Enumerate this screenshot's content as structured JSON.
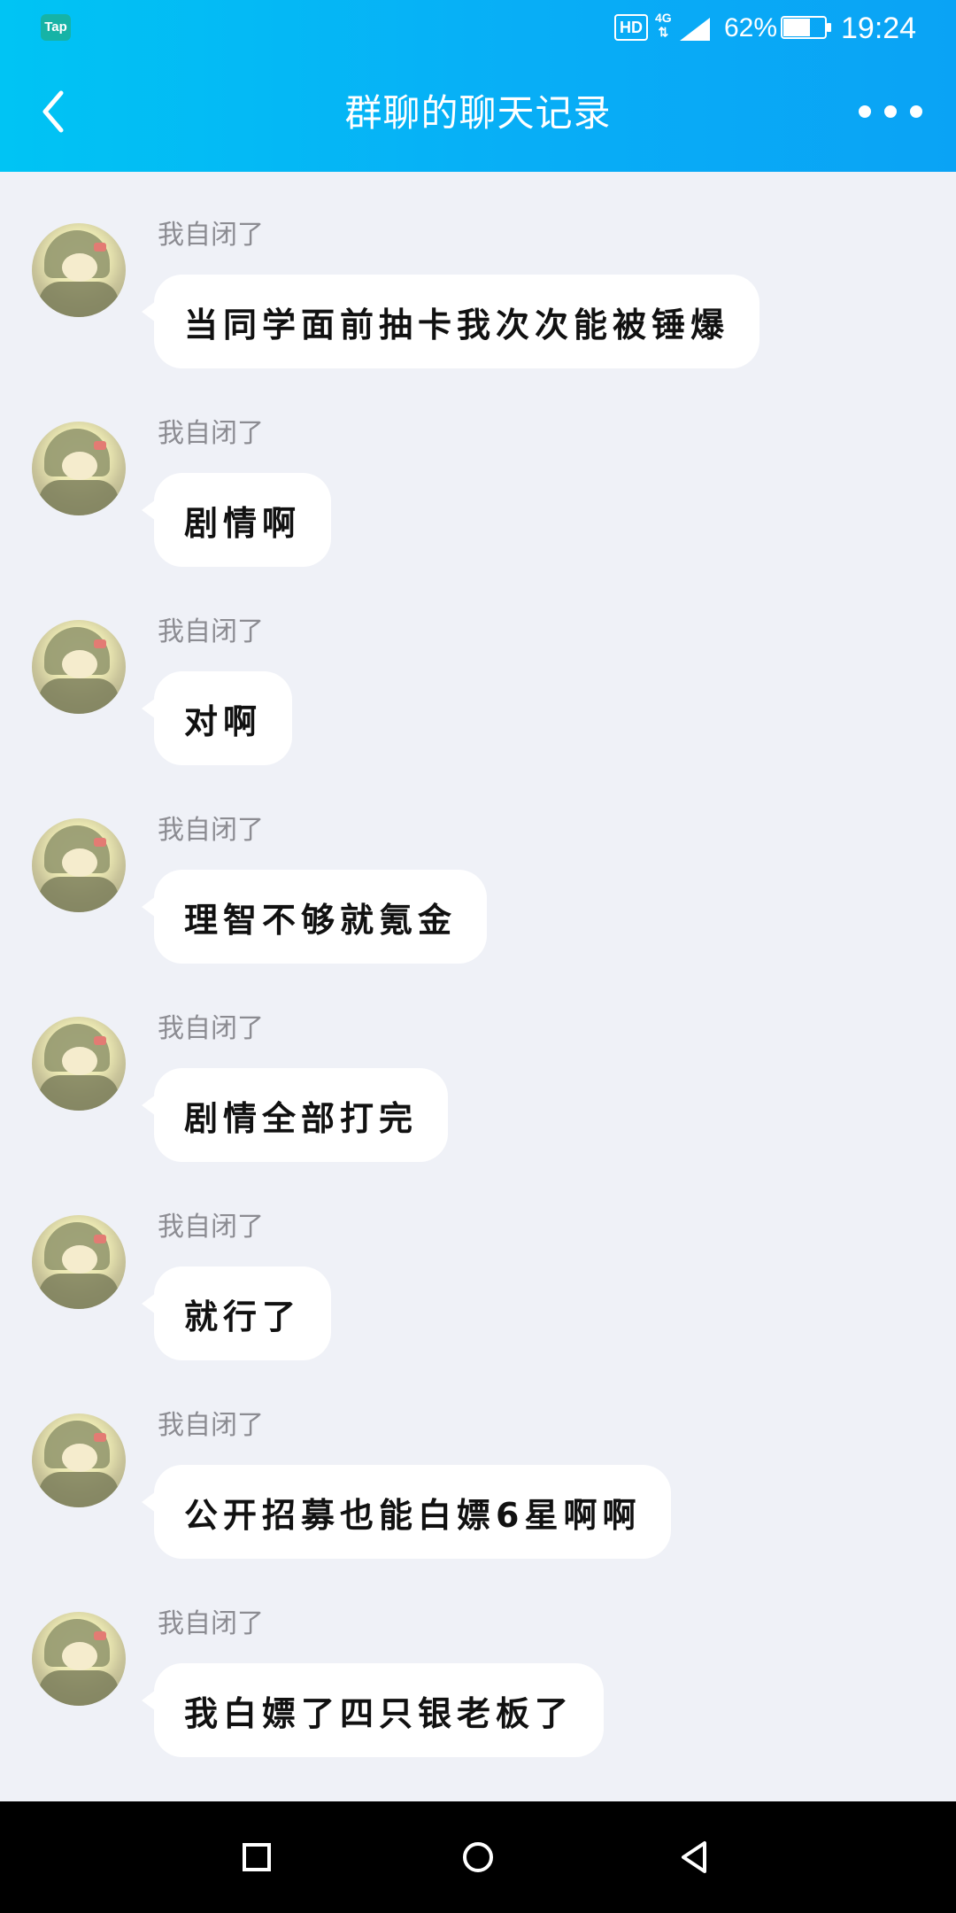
{
  "status_bar": {
    "app_badge": "Tap",
    "hd_badge": "HD",
    "network": "4G",
    "battery": "62%",
    "time": "19:24",
    "icons": [
      "tap-app-icon",
      "hd-icon",
      "4g-icon",
      "signal-icon",
      "battery-icon"
    ]
  },
  "header": {
    "title": "群聊的聊天记录",
    "back_icon": "chevron-left-icon",
    "more_icon": "more-horizontal-icon"
  },
  "messages": [
    {
      "sender": "我自闭了",
      "text": "当同学面前抽卡我次次能被锤爆"
    },
    {
      "sender": "我自闭了",
      "text": "剧情啊"
    },
    {
      "sender": "我自闭了",
      "text": "对啊"
    },
    {
      "sender": "我自闭了",
      "text": "理智不够就氪金"
    },
    {
      "sender": "我自闭了",
      "text": "剧情全部打完"
    },
    {
      "sender": "我自闭了",
      "text": "就行了"
    },
    {
      "sender": "我自闭了",
      "text": "公开招募也能白嫖6星啊啊"
    },
    {
      "sender": "我自闭了",
      "text": "我白嫖了四只银老板了"
    }
  ],
  "nav_bar": {
    "icons": [
      "recents-square-icon",
      "home-circle-icon",
      "back-triangle-icon"
    ]
  },
  "colors": {
    "header_start": "#00c4f4",
    "header_end": "#0aa3f5",
    "chat_background": "#eff1f7",
    "bubble": "#ffffff",
    "sender_name": "#8c8c92",
    "nav_bar": "#000000"
  }
}
